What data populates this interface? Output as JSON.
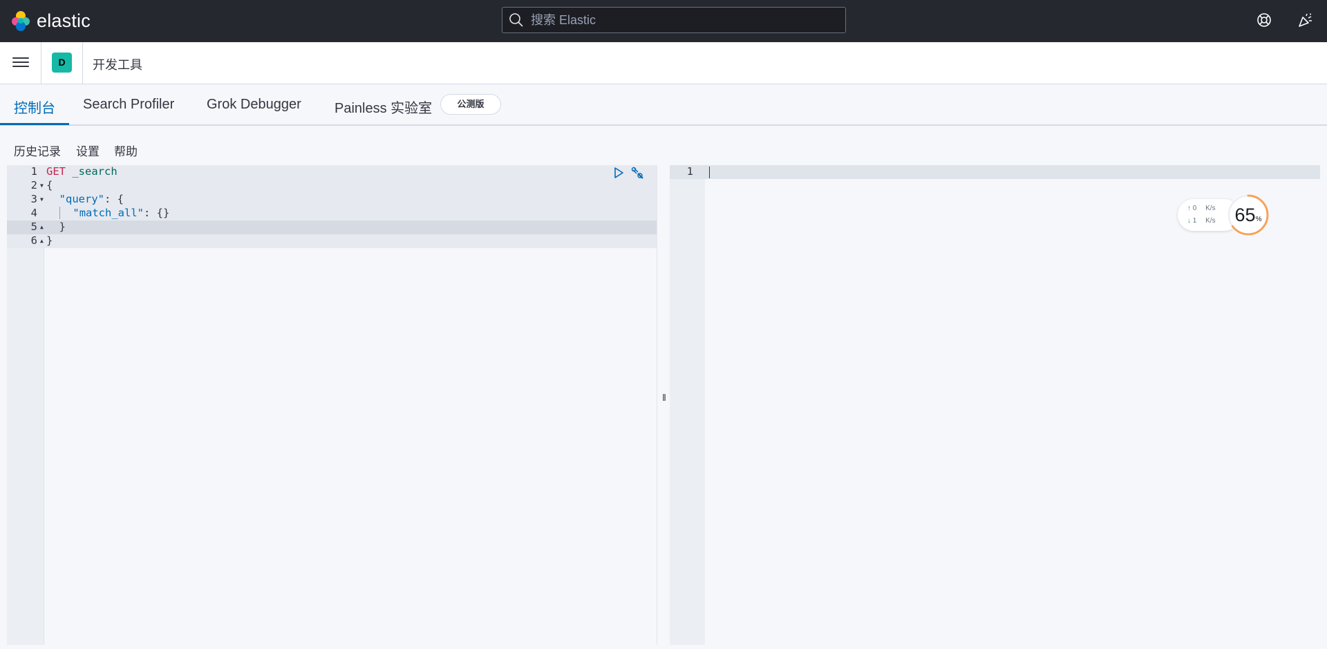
{
  "header": {
    "brand": "elastic",
    "search_placeholder": "搜索 Elastic",
    "help_icon": "help-lifebuoy-icon",
    "news_icon": "newsfeed-icon"
  },
  "breadcrumb": {
    "space_initial": "D",
    "title": "开发工具"
  },
  "tabs": [
    {
      "label": "控制台",
      "active": true
    },
    {
      "label": "Search Profiler",
      "active": false
    },
    {
      "label": "Grok Debugger",
      "active": false
    },
    {
      "label": "Painless 实验室",
      "active": false
    }
  ],
  "beta_badge": "公测版",
  "console_menu": [
    "历史记录",
    "设置",
    "帮助"
  ],
  "request_editor": {
    "line_numbers": [
      "1",
      "2",
      "3",
      "4",
      "5",
      "6"
    ],
    "lines": {
      "l1_method": "GET",
      "l1_path": "_search",
      "l2": "{",
      "l3_key": "\"query\"",
      "l3_rest": ": {",
      "l4_key": "\"match_all\"",
      "l4_rest": ": {}",
      "l5": "}",
      "l6": "}"
    }
  },
  "response_editor": {
    "line_numbers": [
      "1"
    ]
  },
  "net_widget": {
    "upload_value": "0",
    "upload_unit": "K/s",
    "download_value": "1",
    "download_unit": "K/s",
    "cpu_percent": "65",
    "cpu_suffix": "%",
    "cpu_fraction": 0.65
  },
  "colors": {
    "header_bg": "#25282f",
    "accent": "#006bb8",
    "space_avatar": "#16b8a6",
    "method": "#c7254e",
    "gauge": "#f5a35c"
  }
}
